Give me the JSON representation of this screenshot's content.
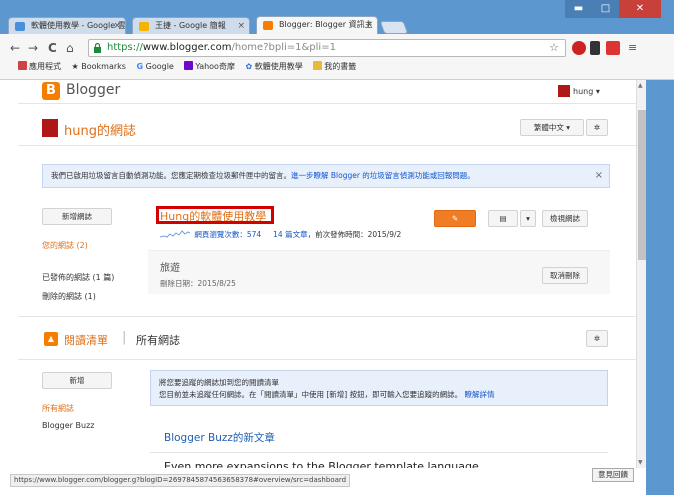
{
  "browser": {
    "tabs": [
      {
        "title": "軟體使用教學 - Google 雲",
        "color": "#4a90d9"
      },
      {
        "title": "王捷 - Google 簡報",
        "color": "#f4b400"
      },
      {
        "title": "Blogger: Blogger 資訊主",
        "color": "#f57d00"
      }
    ],
    "window_controls": {
      "minimize": "▬",
      "maximize": "□",
      "close": "✕"
    },
    "nav": {
      "back": "←",
      "forward": "→",
      "reload": "C",
      "home": "⌂"
    },
    "url": {
      "scheme": "https://",
      "host": "www.blogger.com",
      "path": "/home?bpli=1&pli=1"
    },
    "bookmarks": [
      {
        "label": "應用程式",
        "icon": "apps-icon",
        "color": "#c44"
      },
      {
        "label": "Bookmarks",
        "icon": "star-icon",
        "color": "#999"
      },
      {
        "label": "Google",
        "icon": "google-icon",
        "color": "#4285f4"
      },
      {
        "label": "Yahoo奇摩",
        "icon": "yahoo-icon",
        "color": "#6b0ac9"
      },
      {
        "label": "軟體使用教學",
        "icon": "gear-icon",
        "color": "#3a6ed8"
      },
      {
        "label": "我的書籤",
        "icon": "folder-icon",
        "color": "#e8b93a"
      }
    ]
  },
  "header": {
    "logo_text": "Blogger",
    "user_name": "hung"
  },
  "blog": {
    "name": "hung的網誌",
    "language_button": "繁體中文",
    "notice": {
      "text": "我們已啟用垃圾留言自動偵測功能。您應定期檢查垃圾郵件匣中的留言。",
      "link": "進一步瞭解 Blogger 的垃圾留言偵測功能或回報問題。"
    }
  },
  "sidebar": {
    "new_blog_button": "新增網誌",
    "my_blogs": "您的網誌 (2)",
    "published_blogs": "已發佈的網誌 (1 篇)",
    "deleted_blogs": "刪除的網誌 (1)"
  },
  "blog_list": {
    "active_title": "Hung的軟體使用教學",
    "pageviews_label": "網頁瀏覽次數：574",
    "posts_label": "14 篇文章",
    "published_label": "，前次發佈時間：2015/9/2",
    "view_button": "檢視網誌",
    "deleted_name": "旅遊",
    "deleted_date": "刪除日期：2015/8/25",
    "undelete_button": "取消刪除"
  },
  "reading_list": {
    "title": "閱讀清單",
    "all_blogs": "所有網誌",
    "add_button": "新增",
    "side_all": "所有網誌",
    "side_buzz": "Blogger Buzz",
    "notice_line1": "將您要追蹤的網誌加到您的閱讀清單",
    "notice_line2": "您目前並未追蹤任何網誌。在「閱讀清單」中使用 [新增] 按鈕，即可輸入您要追蹤的網誌。",
    "notice_link": "瞭解詳情",
    "buzz_header": "Blogger Buzz的新文章",
    "buzz_post": "Even more expansions to the Blogger template language"
  },
  "status_url": "https://www.blogger.com/blogger.g?blogID=2697845874563658378#overview/src=dashboard",
  "feedback_button": "意見回饋",
  "colors": {
    "accent": "#f57d00",
    "link": "#1155cc",
    "highlight_box": "#d40000"
  }
}
